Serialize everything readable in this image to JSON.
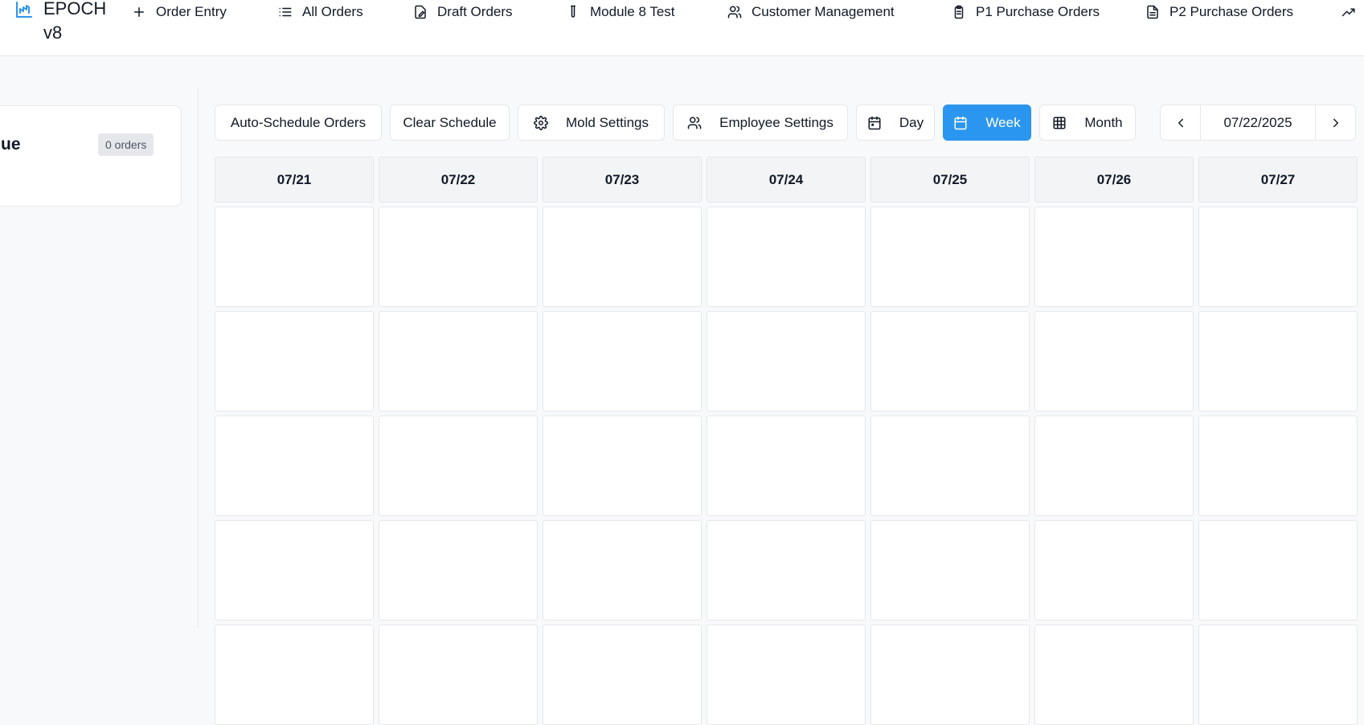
{
  "app": {
    "brand_line1": "EPOCH",
    "brand_line2": "v8",
    "brand_icon": "factory-chart-icon",
    "accent_color": "#2b96ef"
  },
  "nav": {
    "items": [
      {
        "label": "Order Entry",
        "icon": "plus-icon"
      },
      {
        "label": "All Orders",
        "icon": "list-icon"
      },
      {
        "label": "Draft Orders",
        "icon": "edit-document-icon"
      },
      {
        "label": "Module 8 Test",
        "icon": "test-tube-icon"
      },
      {
        "label": "Customer Management",
        "icon": "users-icon"
      },
      {
        "label": "P1 Purchase Orders",
        "icon": "clipboard-icon"
      },
      {
        "label": "P2 Purchase Orders",
        "icon": "document-icon"
      }
    ],
    "overflow_icon": "trending-up-icon"
  },
  "queue": {
    "title": "ue",
    "count": "0 orders"
  },
  "toolbar": {
    "auto_schedule": "Auto-Schedule Orders",
    "clear_schedule": "Clear Schedule",
    "mold_settings": "Mold Settings",
    "employee_settings": "Employee Settings",
    "view_day": "Day",
    "view_week": "Week",
    "view_month": "Month",
    "active_view": "Week",
    "current_date": "07/22/2025"
  },
  "calendar": {
    "days": [
      "07/21",
      "07/22",
      "07/23",
      "07/24",
      "07/25",
      "07/26",
      "07/27"
    ]
  }
}
